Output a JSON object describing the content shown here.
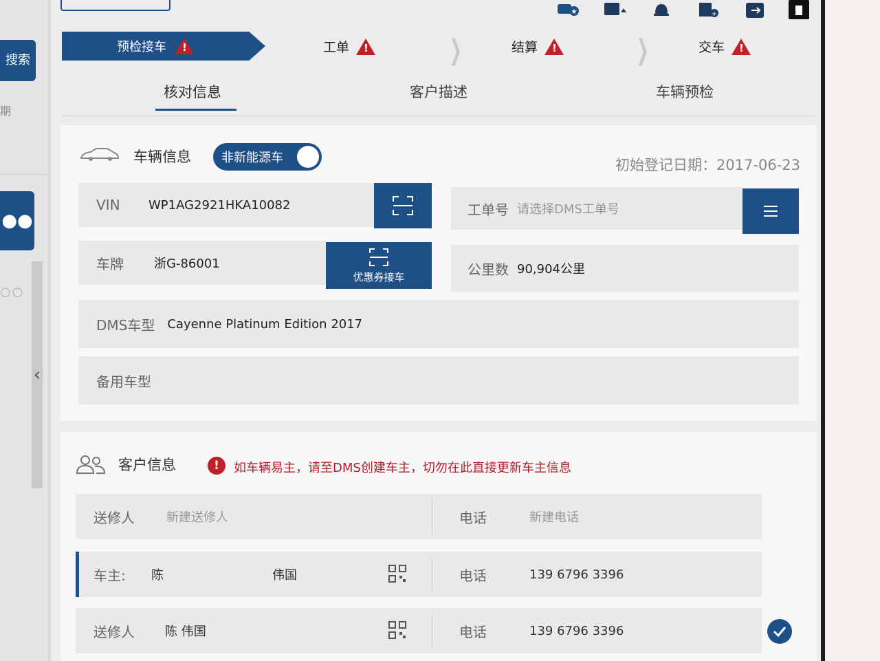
{
  "toolbar": {
    "icons": [
      "car-star-icon",
      "car-upload-icon",
      "bell-icon",
      "add-document-icon",
      "logout-icon",
      "trash-icon"
    ]
  },
  "sidebar": {
    "search_label": "搜索",
    "date_label": "期"
  },
  "steps": [
    {
      "label": "预检接车",
      "active": true
    },
    {
      "label": "工单",
      "active": false
    },
    {
      "label": "结算",
      "active": false
    },
    {
      "label": "交车",
      "active": false
    }
  ],
  "tabs": [
    {
      "label": "核对信息",
      "active": true
    },
    {
      "label": "客户描述",
      "active": false
    },
    {
      "label": "车辆预检",
      "active": false
    }
  ],
  "vehicle": {
    "title": "车辆信息",
    "energy_toggle": "非新能源车",
    "reg_date_label": "初始登记日期：",
    "reg_date": "2017-06-23",
    "vin_label": "VIN",
    "vin": "WP1AG2921HKA10082",
    "plate_label": "车牌",
    "plate": "浙G-86001",
    "coupon_button": "优惠券接车",
    "work_order_label": "工单号",
    "work_order_placeholder": "请选择DMS工单号",
    "mileage_label": "公里数",
    "mileage": "90,904公里",
    "dms_model_label": "DMS车型",
    "dms_model": "Cayenne Platinum Edition 2017",
    "backup_model_label": "备用车型"
  },
  "customer": {
    "title": "客户信息",
    "warning": "如车辆易主，请至DMS创建车主，切勿在此直接更新车主信息",
    "new_sender_label": "送修人",
    "new_sender_placeholder": "新建送修人",
    "phone_label": "电话",
    "new_phone_placeholder": "新建电话",
    "owner_label": "车主:",
    "owner_surname": "陈",
    "owner_given": "伟国",
    "owner_phone": "139 6796 3396",
    "sender_label": "送修人",
    "sender_name": "陈 伟国",
    "sender_phone": "139 6796 3396"
  },
  "colors": {
    "accent": "#1e4f86",
    "warning": "#c0202a"
  }
}
